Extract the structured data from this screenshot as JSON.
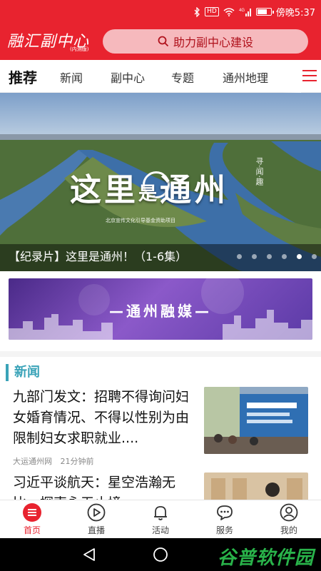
{
  "status_bar": {
    "carrier_text": "傍晚5:37",
    "hd_badge": "HD",
    "network": "4G",
    "icons": [
      "bluetooth-icon",
      "hd-icon",
      "wifi-icon",
      "signal-icon",
      "battery-icon"
    ],
    "battery_level": 0.8
  },
  "header": {
    "logo_text": "融汇副中心",
    "logo_sub": "(内测版)",
    "search_text": "助力副中心建设"
  },
  "tabs": [
    {
      "label": "推荐",
      "active": true
    },
    {
      "label": "新闻"
    },
    {
      "label": "副中心"
    },
    {
      "label": "专题"
    },
    {
      "label": "通州地理"
    }
  ],
  "banner": {
    "big_title_1": "这里",
    "big_title_mid": "是",
    "big_title_2": "通州",
    "caption": "【纪录片】这里是通州！（1-6集）",
    "credit": "北京宣传文化引导基金资助项目",
    "seal": "寻·闻·趣",
    "slide_count": 6,
    "active_slide": 5
  },
  "promo": {
    "text": "—通州融媒—"
  },
  "news": {
    "section_title": "新闻",
    "items": [
      {
        "title": "九部门发文：招聘不得询问妇女婚育情况、不得以性别为由限制妇女求职就业....",
        "source": "大运通州网",
        "time": "21分钟前"
      },
      {
        "title": "习近平谈航天：星空浩瀚无比，探索永无止境",
        "source": "",
        "time": ""
      }
    ]
  },
  "bottom_nav": [
    {
      "label": "首页",
      "icon": "home-icon",
      "active": true
    },
    {
      "label": "直播",
      "icon": "play-icon"
    },
    {
      "label": "活动",
      "icon": "bell-icon"
    },
    {
      "label": "服务",
      "icon": "chat-icon"
    },
    {
      "label": "我的",
      "icon": "user-icon"
    }
  ],
  "watermark": "谷普软件园",
  "colors": {
    "brand_red": "#e8232f",
    "section_teal": "#3aa3b8",
    "promo_purple": "#6b44b0"
  }
}
